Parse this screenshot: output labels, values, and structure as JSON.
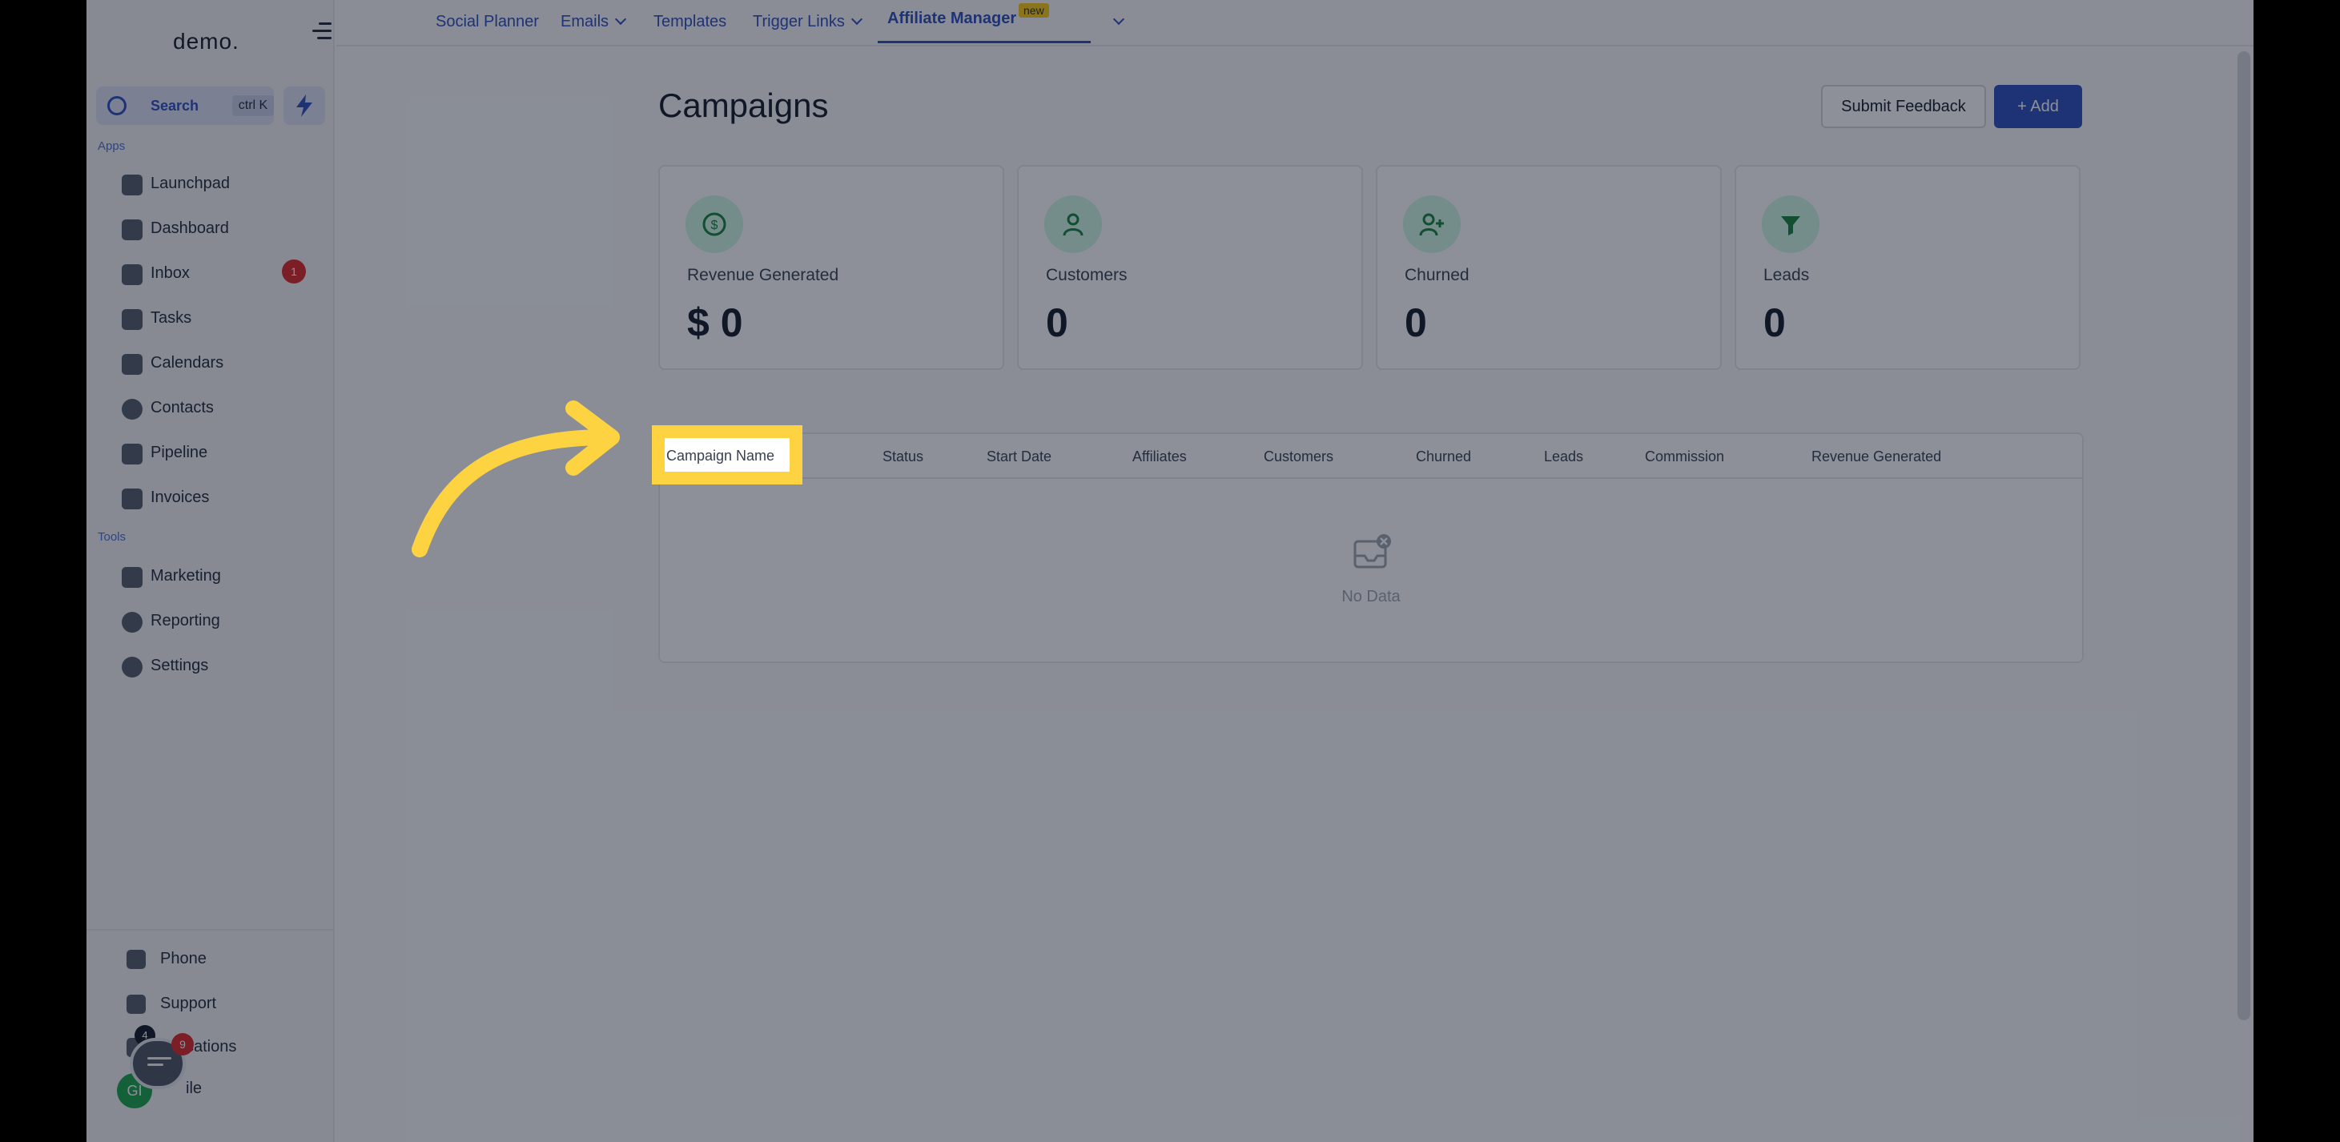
{
  "sidebar": {
    "logo": "demo.",
    "search": {
      "label": "Search",
      "shortcut": "ctrl K"
    },
    "sections": {
      "apps": "Apps",
      "tools": "Tools"
    },
    "apps": [
      {
        "label": "Launchpad",
        "icon": "rocket-icon"
      },
      {
        "label": "Dashboard",
        "icon": "dashboard-icon"
      },
      {
        "label": "Inbox",
        "icon": "inbox-icon",
        "badge": "1"
      },
      {
        "label": "Tasks",
        "icon": "clipboard-icon"
      },
      {
        "label": "Calendars",
        "icon": "calendar-icon"
      },
      {
        "label": "Contacts",
        "icon": "person-icon"
      },
      {
        "label": "Pipeline",
        "icon": "funnel-icon"
      },
      {
        "label": "Invoices",
        "icon": "invoice-icon"
      }
    ],
    "tools": [
      {
        "label": "Marketing",
        "icon": "megaphone-icon"
      },
      {
        "label": "Reporting",
        "icon": "pie-chart-icon"
      },
      {
        "label": "Settings",
        "icon": "gear-icon"
      }
    ],
    "bottom": [
      {
        "label": "Phone",
        "icon": "phone-icon"
      },
      {
        "label": "Support",
        "icon": "chat-bubble-icon"
      },
      {
        "label": "cations",
        "icon": "bell-icon"
      },
      {
        "label": "ile",
        "icon": "user-icon"
      }
    ],
    "chat_badge": "9",
    "notif_badge": "4",
    "avatar_initials": "GI"
  },
  "topbar": {
    "tabs": [
      {
        "label": "Social Planner"
      },
      {
        "label": "Emails"
      },
      {
        "label": "Templates"
      },
      {
        "label": "Trigger Links"
      },
      {
        "label": "Affiliate Manager"
      }
    ],
    "new_tag": "new"
  },
  "main": {
    "title": "Campaigns",
    "feedback_label": "Submit Feedback",
    "add_label": "+ Add",
    "cards": [
      {
        "label": "Revenue Generated",
        "value": "$ 0",
        "icon": "dollar-icon"
      },
      {
        "label": "Customers",
        "value": "0",
        "icon": "person-icon"
      },
      {
        "label": "Churned",
        "value": "0",
        "icon": "person-plus-icon"
      },
      {
        "label": "Leads",
        "value": "0",
        "icon": "funnel-icon"
      }
    ],
    "table": {
      "columns": [
        "Campaign Name",
        "Status",
        "Start Date",
        "Affiliates",
        "Customers",
        "Churned",
        "Leads",
        "Commission",
        "Revenue Generated"
      ],
      "empty_text": "No Data"
    }
  },
  "colors": {
    "accent": "#2b4bbf",
    "highlight": "#fdd341",
    "badge": "#dc2626",
    "card_icon_bg": "#d1fae5"
  }
}
